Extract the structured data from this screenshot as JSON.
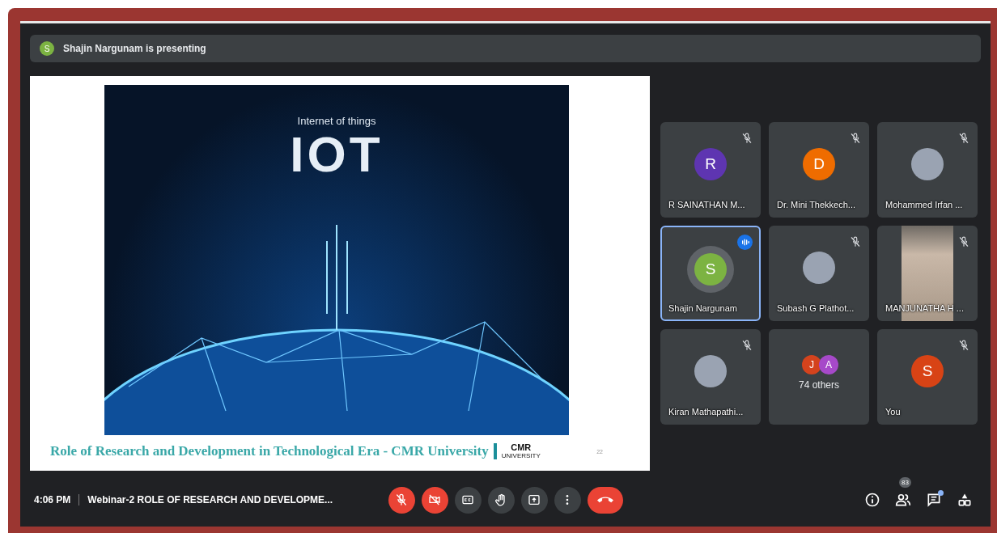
{
  "presenting_banner": {
    "initial": "S",
    "color": "#7cb342",
    "text": "Shajin Nargunam is presenting"
  },
  "slide": {
    "subtitle": "Internet of things",
    "title": "IOT",
    "footer": "Role of Research and Development in Technological Era - CMR University",
    "logo_text": "CMR",
    "logo_subtext": "UNIVERSITY",
    "page_number": "22"
  },
  "participants": [
    {
      "kind": "avatar",
      "name": "R SAINATHAN M...",
      "initial": "R",
      "color": "#5e35b1",
      "muted": true,
      "speaking": false
    },
    {
      "kind": "avatar",
      "name": "Dr. Mini Thekkech...",
      "initial": "D",
      "color": "#ef6c00",
      "muted": true,
      "speaking": false
    },
    {
      "kind": "photo",
      "name": "Mohammed Irfan ...",
      "muted": true,
      "speaking": false
    },
    {
      "kind": "avatar",
      "name": "Shajin Nargunam",
      "initial": "S",
      "color": "#7cb342",
      "muted": false,
      "speaking": true
    },
    {
      "kind": "photo",
      "name": "Subash G Plathot...",
      "muted": true,
      "speaking": false
    },
    {
      "kind": "video",
      "name": "MANJUNATHA H ...",
      "muted": true,
      "speaking": false
    },
    {
      "kind": "photo",
      "name": "Kiran Mathapathi...",
      "muted": true,
      "speaking": false
    },
    {
      "kind": "others",
      "label": "74 others",
      "avatars": [
        {
          "initial": "J",
          "color": "#d4431d"
        },
        {
          "initial": "A",
          "color": "#a649c9"
        }
      ]
    },
    {
      "kind": "avatar",
      "name": "You",
      "initial": "S",
      "color": "#d84315",
      "muted": true,
      "speaking": false
    }
  ],
  "meeting_bar": {
    "time": "4:06 PM",
    "title": "Webinar-2 ROLE OF RESEARCH AND DEVELOPME...",
    "controls": [
      {
        "kind": "mic",
        "on": false
      },
      {
        "kind": "camera",
        "on": false
      },
      {
        "kind": "captions",
        "on": false
      },
      {
        "kind": "raise_hand",
        "on": false
      },
      {
        "kind": "present",
        "on": false
      },
      {
        "kind": "more"
      },
      {
        "kind": "leave"
      }
    ]
  },
  "side_controls": [
    {
      "kind": "info"
    },
    {
      "kind": "people",
      "badge": "83"
    },
    {
      "kind": "chat",
      "unread": true
    },
    {
      "kind": "activities"
    }
  ]
}
